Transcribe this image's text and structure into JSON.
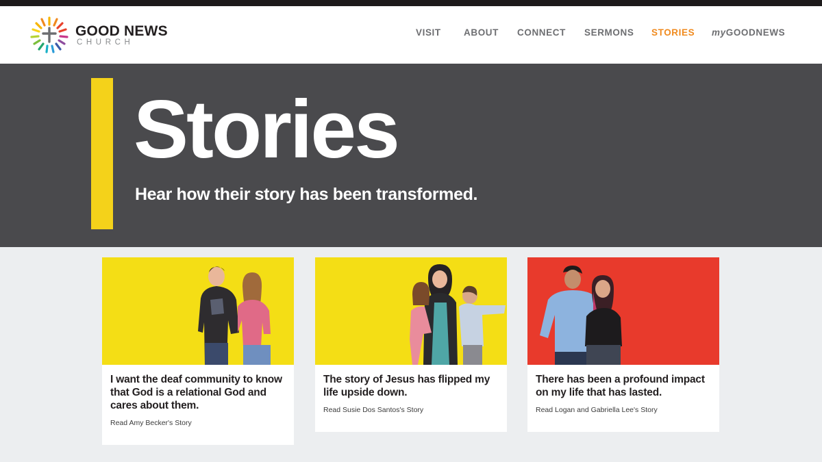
{
  "brand": {
    "title": "GOOD NEWS",
    "subtitle": "CHURCH"
  },
  "nav": {
    "items": [
      {
        "label": "VISIT"
      },
      {
        "label": "ABOUT"
      },
      {
        "label": "CONNECT"
      },
      {
        "label": "SERMONS"
      },
      {
        "label": "STORIES",
        "active": true
      },
      {
        "label_prefix": "my",
        "label": "GOODNEWS"
      }
    ]
  },
  "hero": {
    "title": "Stories",
    "subtitle": "Hear how their story has been transformed."
  },
  "cards": [
    {
      "title": "I want the deaf community to know that God is a relational God and cares about them.",
      "link": "Read Amy Becker's Story",
      "bg": "#f4de15"
    },
    {
      "title": "The story of Jesus has flipped my life upside down.",
      "link": "Read Susie Dos Santos's Story",
      "bg": "#f4de15"
    },
    {
      "title": "There has been a profound impact on my life that has lasted.",
      "link": "Read Logan and Gabriella Lee's Story",
      "bg": "#e83a2c"
    }
  ],
  "colors": {
    "accent_yellow": "#f4d21a",
    "active_nav": "#f08a1e",
    "hero_bg": "#4a4a4d",
    "page_bg": "#eceef0"
  }
}
